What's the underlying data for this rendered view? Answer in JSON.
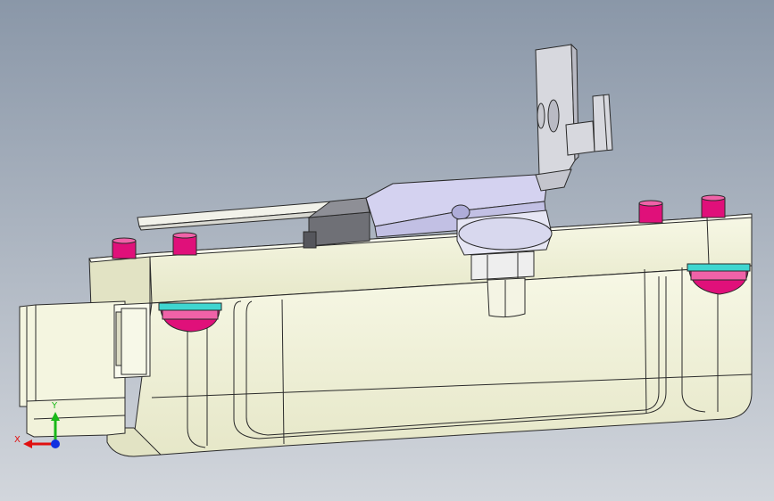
{
  "viewport": {
    "background_top": "#8a97a8",
    "background_bottom": "#d2d6dc"
  },
  "model": {
    "body_color": "#f3f4dc",
    "body_shade": "#e2e3c4",
    "edge_color": "#2a2a2a",
    "bracket_color": "#d7d8de",
    "bracket_shade": "#b9bac4",
    "arm_color": "#d4d2f0",
    "motor_color": "#6f7076",
    "fastener_color": "#e0107a",
    "fastener_highlight": "#f062a8",
    "washer_color": "#3fd6d0"
  },
  "triad": {
    "x_label": "X",
    "y_label": "Y",
    "x_color": "#e01010",
    "y_color": "#18b818",
    "z_color": "#1030e0"
  }
}
